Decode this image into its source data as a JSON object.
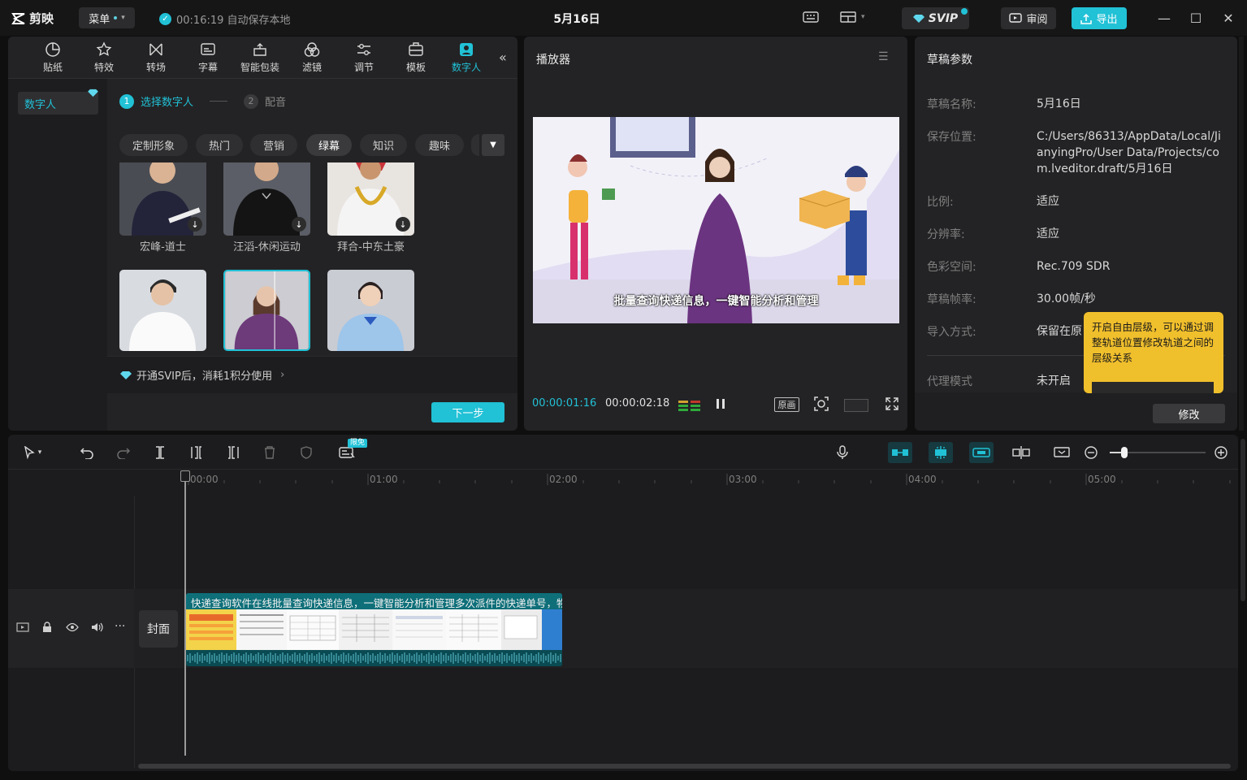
{
  "titlebar": {
    "app_name": "剪映",
    "menu_label": "菜单",
    "autosave": "00:16:19 自动保存本地",
    "doc_title": "5月16日",
    "svip_label": "SVIP",
    "review_label": "审阅",
    "export_label": "导出"
  },
  "tool_tabs": [
    {
      "label": "贴纸",
      "icon": "sticker-icon"
    },
    {
      "label": "特效",
      "icon": "effects-icon"
    },
    {
      "label": "转场",
      "icon": "transition-icon"
    },
    {
      "label": "字幕",
      "icon": "subtitle-icon"
    },
    {
      "label": "智能包装",
      "icon": "smart-pack-icon"
    },
    {
      "label": "滤镜",
      "icon": "filter-icon"
    },
    {
      "label": "调节",
      "icon": "adjust-icon"
    },
    {
      "label": "模板",
      "icon": "template-icon"
    },
    {
      "label": "数字人",
      "icon": "digital-human-icon",
      "active": true
    }
  ],
  "left_panel": {
    "side_item": "数字人",
    "step1": "选择数字人",
    "step2": "配音",
    "step1_num": "1",
    "step2_num": "2",
    "chips": [
      "定制形象",
      "热门",
      "营销",
      "绿幕",
      "知识",
      "趣味"
    ],
    "avatars": [
      {
        "name": "宏峰-道士",
        "download": true
      },
      {
        "name": "汪滔-休闲运动",
        "download": true
      },
      {
        "name": "拜合-中东土豪",
        "download": true
      },
      {
        "name": "",
        "download": false
      },
      {
        "name": "",
        "download": false,
        "selected": true
      },
      {
        "name": "",
        "download": false
      }
    ],
    "svip_hint": "开通SVIP后，消耗1积分使用",
    "next_button": "下一步"
  },
  "player": {
    "title": "播放器",
    "subtitle": "批量查询快递信息，一键智能分析和管理",
    "time_current": "00:00:01:16",
    "time_total": "00:00:02:18",
    "ratio_label": "原画"
  },
  "params": {
    "title": "草稿参数",
    "rows": [
      {
        "label": "草稿名称:",
        "value": "5月16日"
      },
      {
        "label": "保存位置:",
        "value": "C:/Users/86313/AppData/Local/JianyingPro/User Data/Projects/com.lveditor.draft/5月16日"
      },
      {
        "label": "比例:",
        "value": "适应"
      },
      {
        "label": "分辨率:",
        "value": "适应"
      },
      {
        "label": "色彩空间:",
        "value": "Rec.709 SDR"
      },
      {
        "label": "草稿帧率:",
        "value": "30.00帧/秒"
      },
      {
        "label": "导入方式:",
        "value": "保留在原"
      }
    ],
    "proxy_label": "代理模式",
    "proxy_value": "未开启",
    "modify_button": "修改",
    "tooltip": "开启自由层级，可以通过调整轨道位置修改轨道之间的层级关系"
  },
  "timeline": {
    "free_badge": "限免",
    "ruler": [
      "00:00",
      "01:00",
      "02:00",
      "03:00",
      "04:00",
      "05:00"
    ],
    "cover_label": "封面",
    "clip_title": "快递查询软件在线批量查询快递信息，一键智能分析和管理多次派件的快递单号，物",
    "zoom_level": 0.15
  },
  "colors": {
    "accent": "#21c1d6",
    "tooltip": "#f0bf2c",
    "clip": "#0f5e67"
  }
}
